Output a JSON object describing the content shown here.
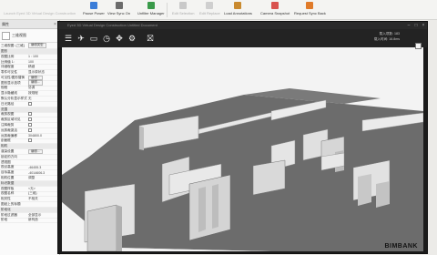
{
  "app": {
    "title": "Launch Eyed 3D Virtual Design Construction"
  },
  "toolbar": {
    "buttons": [
      {
        "label": "Pause Power",
        "enabled": true
      },
      {
        "label": "View Sync On",
        "enabled": true
      },
      {
        "label": "Unfilter Manager",
        "enabled": true
      },
      {
        "label": "Edit Selection",
        "enabled": false
      },
      {
        "label": "Edit Replace",
        "enabled": false
      },
      {
        "label": "Load Annotations",
        "enabled": true
      },
      {
        "label": "Camera Snapshot",
        "enabled": true
      },
      {
        "label": "Request Sync Back",
        "enabled": true
      }
    ]
  },
  "properties": {
    "header": "属性",
    "type_name": "三维视图",
    "filter_label": "三维视图: {三维}",
    "edit_type_label": "编辑类型",
    "rows": [
      {
        "k": "图形",
        "v": "",
        "group": true
      },
      {
        "k": "视图比例",
        "v": "1 : 100"
      },
      {
        "k": "比例值 1:",
        "v": "100"
      },
      {
        "k": "详细程度",
        "v": "精细"
      },
      {
        "k": "零件可见性",
        "v": "显示原状态"
      },
      {
        "k": "可见性/图形替换",
        "v": "编辑...",
        "button": true
      },
      {
        "k": "图形显示选项",
        "v": "编辑...",
        "button": true
      },
      {
        "k": "规程",
        "v": "协调"
      },
      {
        "k": "显示隐藏线",
        "v": "按规程"
      },
      {
        "k": "默认分析显示样式",
        "v": "无"
      },
      {
        "k": "日光路径",
        "v": "",
        "check": true
      },
      {
        "k": "范围",
        "v": "",
        "group": true
      },
      {
        "k": "裁剪视图",
        "v": "",
        "check": true
      },
      {
        "k": "裁剪区域可见",
        "v": "",
        "check": true
      },
      {
        "k": "注释裁剪",
        "v": "",
        "check": true
      },
      {
        "k": "远剪裁激活",
        "v": "",
        "check": true
      },
      {
        "k": "远剪裁偏移",
        "v": "304800.0"
      },
      {
        "k": "剖面框",
        "v": "",
        "check": true
      },
      {
        "k": "相机",
        "v": "",
        "group": true
      },
      {
        "k": "渲染设置",
        "v": "编辑...",
        "button": true
      },
      {
        "k": "锁定的方向",
        "v": ""
      },
      {
        "k": "透视图",
        "v": ""
      },
      {
        "k": "视点高度",
        "v": "-46455.3"
      },
      {
        "k": "目标高度",
        "v": "-4014606.3"
      },
      {
        "k": "相机位置",
        "v": "调整"
      },
      {
        "k": "标识数据",
        "v": "",
        "group": true
      },
      {
        "k": "视图样板",
        "v": "<无>"
      },
      {
        "k": "视图名称",
        "v": "{三维}"
      },
      {
        "k": "相关性",
        "v": "不相关"
      },
      {
        "k": "图纸上的标题",
        "v": ""
      },
      {
        "k": "阶段化",
        "v": "",
        "group": true
      },
      {
        "k": "阶段过滤器",
        "v": "全部显示"
      },
      {
        "k": "阶段",
        "v": "新构造"
      }
    ]
  },
  "viewer": {
    "title": "Eyed 3D Virtual Design Construction Untitled Document",
    "info_line1": "载入项数: 183",
    "info_line2": "载入时间: 16.8ms",
    "watermark": "BIMBANK"
  }
}
